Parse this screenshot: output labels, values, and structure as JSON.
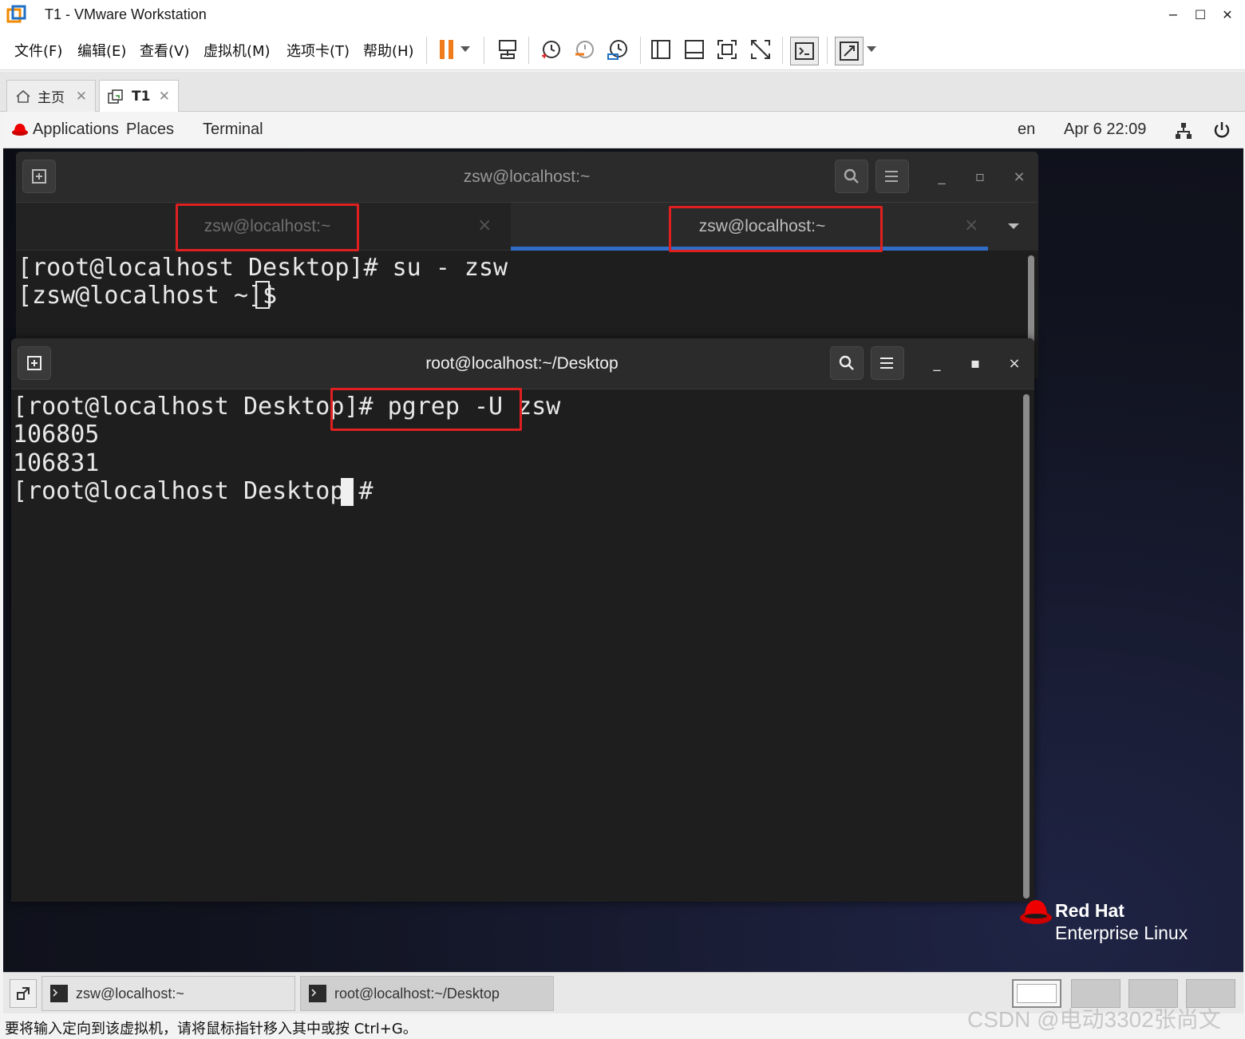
{
  "window": {
    "title": "T1 - VMware Workstation",
    "minimize": "−",
    "maximize": "☐",
    "close": "✕"
  },
  "menu": [
    "文件(F)",
    "编辑(E)",
    "查看(V)",
    "虚拟机(M)",
    "选项卡(T)",
    "帮助(H)"
  ],
  "vm_tabs": [
    {
      "label": "主页",
      "icon": "home-icon",
      "close": "✕"
    },
    {
      "label": "T1",
      "icon": "vm-icon",
      "close": "✕"
    }
  ],
  "gnome_bar": {
    "applications": "Applications",
    "places": "Places",
    "terminal": "Terminal",
    "lang": "en",
    "clock": "Apr 6  22:09"
  },
  "terminal_back": {
    "title": "zsw@localhost:~",
    "tabs": [
      {
        "label": "zsw@localhost:~",
        "close": "×"
      },
      {
        "label": "zsw@localhost:~",
        "close": "×"
      }
    ],
    "lines": [
      "[root@localhost Desktop]# su - zsw",
      "[zsw@localhost ~]$ "
    ]
  },
  "terminal_front": {
    "title": "root@localhost:~/Desktop",
    "lines": [
      "[root@localhost Desktop]# pgrep -U zsw",
      "106805",
      "106831",
      "[root@localhost Desktop]# "
    ]
  },
  "branding": {
    "line1": "Red Hat",
    "line2": "Enterprise Linux"
  },
  "taskbar": [
    {
      "label": "zsw@localhost:~"
    },
    {
      "label": "root@localhost:~/Desktop"
    }
  ],
  "status": "要将输入定向到该虚拟机，请将鼠标指针移入其中或按 Ctrl+G。",
  "watermark": "CSDN @电动3302张尚文",
  "colors": {
    "accent_red": "#e02020",
    "tab_underline": "#2f6dc6",
    "redhat": "#ee0000"
  }
}
